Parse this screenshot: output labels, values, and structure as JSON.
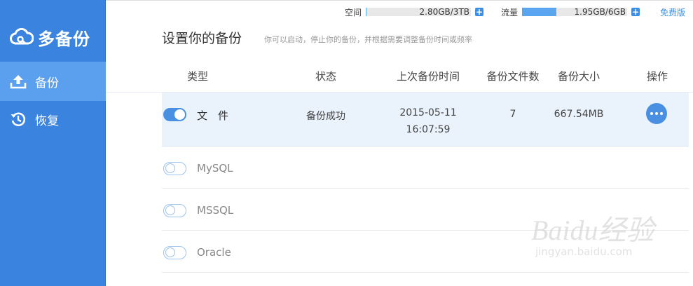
{
  "app": {
    "name": "多备份"
  },
  "sidebar": {
    "items": [
      {
        "label": "备份",
        "icon": "upload-icon",
        "active": true
      },
      {
        "label": "恢复",
        "icon": "history-icon",
        "active": false
      }
    ]
  },
  "quota": {
    "space": {
      "label": "空间",
      "value": "2.80GB/3TB",
      "fill_fraction": 0.001
    },
    "traffic": {
      "label": "流量",
      "value": "1.95GB/6GB",
      "fill_fraction": 0.325
    },
    "plus_label": "+",
    "free_label": "免费版"
  },
  "page": {
    "title": "设置你的备份",
    "subtitle": "你可以启动，停止你的备份，并根据需要调整备份时间或频率"
  },
  "table": {
    "columns": [
      "类型",
      "状态",
      "上次备份时间",
      "备份文件数",
      "备份大小",
      "操作"
    ],
    "rows": [
      {
        "name": "文　件",
        "enabled": true,
        "status": "备份成功",
        "date": "2015-05-11",
        "time": "16:07:59",
        "count": "7",
        "size": "667.54MB"
      },
      {
        "name": "MySQL",
        "enabled": false
      },
      {
        "name": "MSSQL",
        "enabled": false
      },
      {
        "name": "Oracle",
        "enabled": false
      }
    ]
  },
  "watermark": {
    "text": "Baidu经验",
    "sub": "jingyan.baidu.com"
  },
  "colors": {
    "sidebar": "#3a84e0",
    "sidebar_active": "#5aa0ee",
    "accent": "#4a90e2",
    "row_active": "#eaf2fc"
  }
}
